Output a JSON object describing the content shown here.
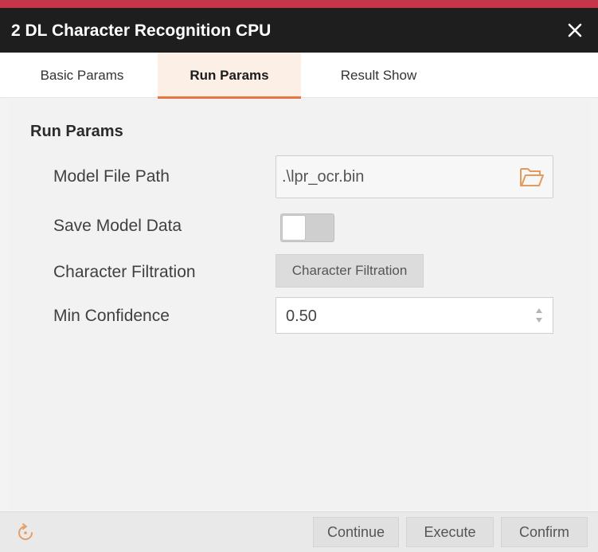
{
  "window": {
    "title": "2 DL Character Recognition CPU",
    "close_icon": "close-icon"
  },
  "tabs": [
    {
      "label": "Basic Params",
      "active": false
    },
    {
      "label": "Run Params",
      "active": true
    },
    {
      "label": "Result Show",
      "active": false
    }
  ],
  "run_params": {
    "section_title": "Run Params",
    "model_file_path": {
      "label": "Model File Path",
      "value": ".\\lpr_ocr.bin",
      "icon": "folder-open-icon"
    },
    "save_model_data": {
      "label": "Save Model Data",
      "enabled": false
    },
    "character_filtration": {
      "label": "Character Filtration",
      "button_label": "Character Filtration"
    },
    "min_confidence": {
      "label": "Min Confidence",
      "value": "0.50"
    }
  },
  "footer": {
    "refresh_icon": "refresh-icon",
    "continue_label": "Continue",
    "execute_label": "Execute",
    "confirm_label": "Confirm"
  },
  "colors": {
    "titlebar": "#1e1e1e",
    "accent_top": "#c7354a",
    "tab_active_underline": "#e8773f",
    "tab_active_bg": "#fcefe6",
    "folder_icon": "#e39a5c"
  }
}
